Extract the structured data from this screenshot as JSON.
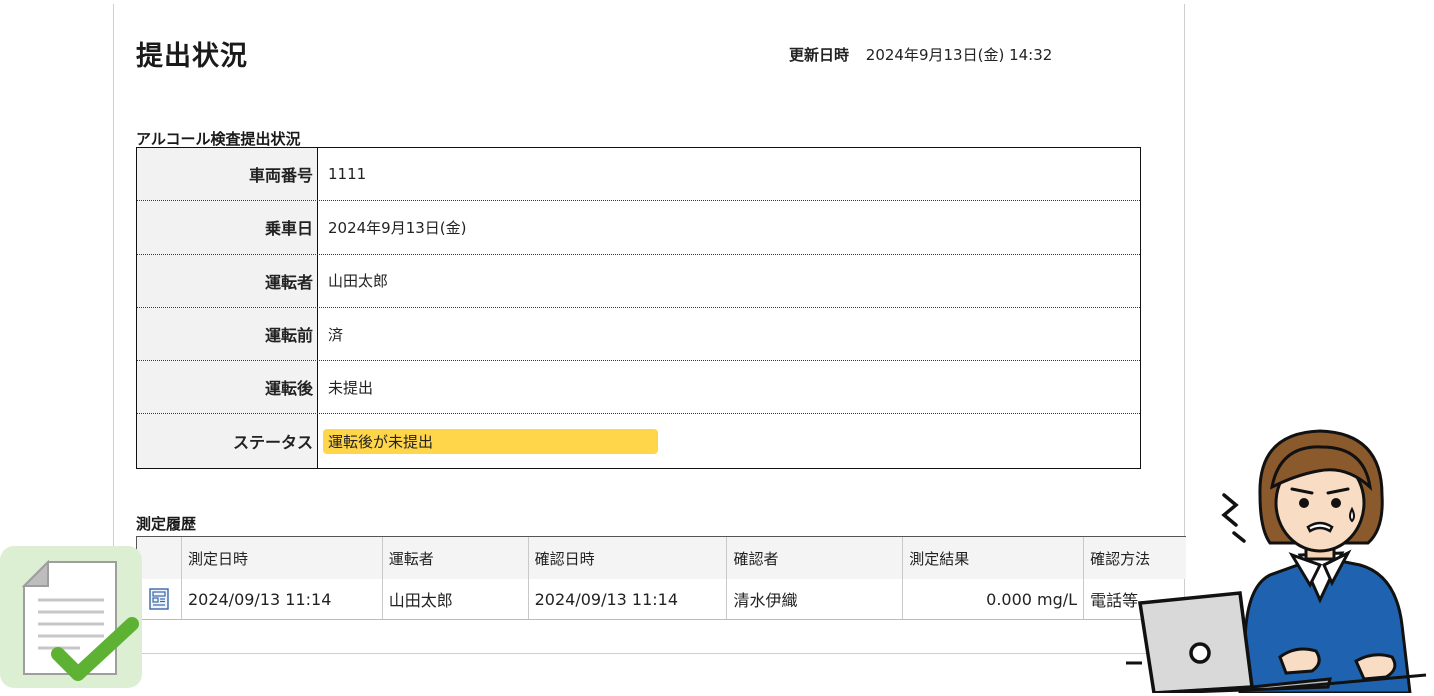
{
  "page": {
    "title": "提出状況",
    "updated_label": "更新日時",
    "updated_value": "2024年9月13日(金) 14:32"
  },
  "alcohol_section": {
    "title": "アルコール検査提出状況",
    "rows": [
      {
        "label": "車両番号",
        "value": "1111"
      },
      {
        "label": "乗車日",
        "value": "2024年9月13日(金)"
      },
      {
        "label": "運転者",
        "value": "山田太郎"
      },
      {
        "label": "運転前",
        "value": "済"
      },
      {
        "label": "運転後",
        "value": "未提出"
      }
    ],
    "status": {
      "label": "ステータス",
      "value": "運転後が未提出",
      "color": "#ffd54a"
    }
  },
  "history_section": {
    "title": "測定履歴",
    "columns": [
      "測定日時",
      "運転者",
      "確認日時",
      "確認者",
      "測定結果",
      "確認方法"
    ],
    "rows": [
      {
        "measured_at": "2024/09/13 11:14",
        "driver": "山田太郎",
        "confirmed_at": "2024/09/13 11:14",
        "confirmer": "清水伊織",
        "result": "0.000 mg/L",
        "method": "電話等"
      }
    ]
  },
  "icons": {
    "row_detail": "document-detail-icon",
    "left_illustration": "checked-document-icon",
    "right_illustration": "worried-person-laptop-illustration"
  },
  "colors": {
    "status_highlight": "#ffd54a",
    "check_green": "#5db233",
    "jacket_blue": "#1f63b0"
  }
}
